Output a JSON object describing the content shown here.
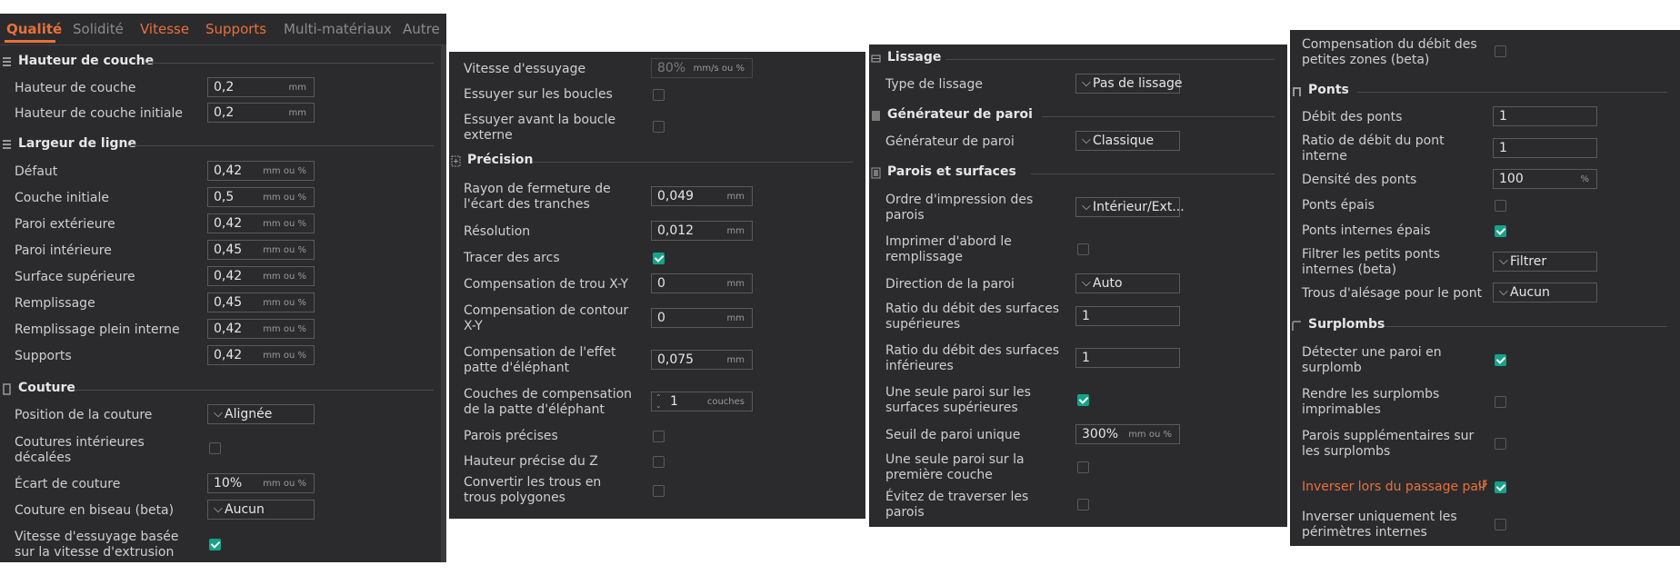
{
  "tabs": [
    {
      "label": "Qualité",
      "state": "active"
    },
    {
      "label": "Solidité",
      "state": "gray"
    },
    {
      "label": "Vitesse",
      "state": "orange"
    },
    {
      "label": "Supports",
      "state": "orange"
    },
    {
      "label": "Multi-matériaux",
      "state": "gray"
    },
    {
      "label": "Autre",
      "state": "gray"
    }
  ],
  "units": {
    "mm": "mm",
    "mm_pct": "mm ou %",
    "mms_pct": "mm/s ou %",
    "pct": "%",
    "couches": "couches"
  },
  "panel1": {
    "sections": {
      "couche": "Hauteur de couche",
      "ligne": "Largeur de ligne",
      "couture": "Couture"
    },
    "rows": [
      {
        "label": "Hauteur de couche",
        "value": "0,2"
      },
      {
        "label": "Hauteur de couche initiale",
        "value": "0,2"
      },
      {
        "label": "Défaut",
        "value": "0,42"
      },
      {
        "label": "Couche initiale",
        "value": "0,5"
      },
      {
        "label": "Paroi extérieure",
        "value": "0,42"
      },
      {
        "label": "Paroi intérieure",
        "value": "0,45"
      },
      {
        "label": "Surface supérieure",
        "value": "0,42"
      },
      {
        "label": "Remplissage",
        "value": "0,45"
      },
      {
        "label": "Remplissage plein interne",
        "value": "0,42"
      },
      {
        "label": "Supports",
        "value": "0,42"
      },
      {
        "label": "Position de la couture",
        "value": "Alignée"
      },
      {
        "label": "Coutures intérieures décalées",
        "value": ""
      },
      {
        "label": "Écart de couture",
        "value": "10%"
      },
      {
        "label": "Couture en biseau (beta)",
        "value": "Aucun"
      },
      {
        "label": "Vitesse d'essuyage basée sur la vitesse d'extrusion",
        "value": ""
      }
    ]
  },
  "panel2": {
    "sections": {
      "precision": "Précision"
    },
    "rows": [
      {
        "label": "Vitesse d'essuyage",
        "value": "80%"
      },
      {
        "label": "Essuyer sur les boucles",
        "value": ""
      },
      {
        "label": "Essuyer avant la boucle externe",
        "value": ""
      },
      {
        "label": "Rayon de fermeture de l'écart des tranches",
        "value": "0,049"
      },
      {
        "label": "Résolution",
        "value": "0,012"
      },
      {
        "label": "Tracer des arcs",
        "value": ""
      },
      {
        "label": "Compensation de trou X-Y",
        "value": "0"
      },
      {
        "label": "Compensation de contour X-Y",
        "value": "0"
      },
      {
        "label": "Compensation de l'effet patte d'éléphant",
        "value": "0,075"
      },
      {
        "label": "Couches de compensation de la patte d'éléphant",
        "value": "1"
      },
      {
        "label": "Parois précises",
        "value": ""
      },
      {
        "label": "Hauteur précise du Z",
        "value": ""
      },
      {
        "label": "Convertir les trous en trous polygones",
        "value": ""
      }
    ]
  },
  "panel3": {
    "sections": {
      "lissage": "Lissage",
      "generateur": "Générateur de paroi",
      "parois": "Parois et surfaces"
    },
    "rows": [
      {
        "label": "Type de lissage",
        "value": "Pas de lissage"
      },
      {
        "label": "Générateur de paroi",
        "value": "Classique"
      },
      {
        "label": "Ordre d'impression des parois",
        "value": "Intérieur/Ext..."
      },
      {
        "label": "Imprimer d'abord le remplissage",
        "value": ""
      },
      {
        "label": "Direction de la paroi",
        "value": "Auto"
      },
      {
        "label": "Ratio du débit des surfaces supérieures",
        "value": "1"
      },
      {
        "label": "Ratio du débit des surfaces inférieures",
        "value": "1"
      },
      {
        "label": "Une seule paroi sur les surfaces supérieures",
        "value": ""
      },
      {
        "label": "Seuil de paroi unique",
        "value": "300%"
      },
      {
        "label": "Une seule paroi sur la première couche",
        "value": ""
      },
      {
        "label": "Évitez de traverser les parois",
        "value": ""
      }
    ]
  },
  "panel4": {
    "sections": {
      "ponts": "Ponts",
      "surplombs": "Surplombs"
    },
    "rows": [
      {
        "label": "Compensation du débit des petites zones (beta)",
        "value": ""
      },
      {
        "label": "Débit des ponts",
        "value": "1"
      },
      {
        "label": "Ratio de débit du pont interne",
        "value": "1"
      },
      {
        "label": "Densité des ponts",
        "value": "100"
      },
      {
        "label": "Ponts épais",
        "value": ""
      },
      {
        "label": "Ponts internes épais",
        "value": ""
      },
      {
        "label": "Filtrer les petits ponts internes (beta)",
        "value": "Filtrer"
      },
      {
        "label": "Trous d'alésage pour le pont",
        "value": "Aucun"
      },
      {
        "label": "Détecter une paroi en surplomb",
        "value": ""
      },
      {
        "label": "Rendre les surplombs imprimables",
        "value": ""
      },
      {
        "label": "Parois supplémentaires sur les surplombs",
        "value": ""
      },
      {
        "label": "Inverser lors du passage pair",
        "value": ""
      },
      {
        "label": "Inverser uniquement les périmètres internes",
        "value": ""
      }
    ]
  },
  "colors": {
    "accent": "#e8703a",
    "check": "#13a38a",
    "panel": "#2b2b2d"
  },
  "icons": {
    "reset": "reset-icon",
    "chevron": "chevron-down-icon"
  }
}
